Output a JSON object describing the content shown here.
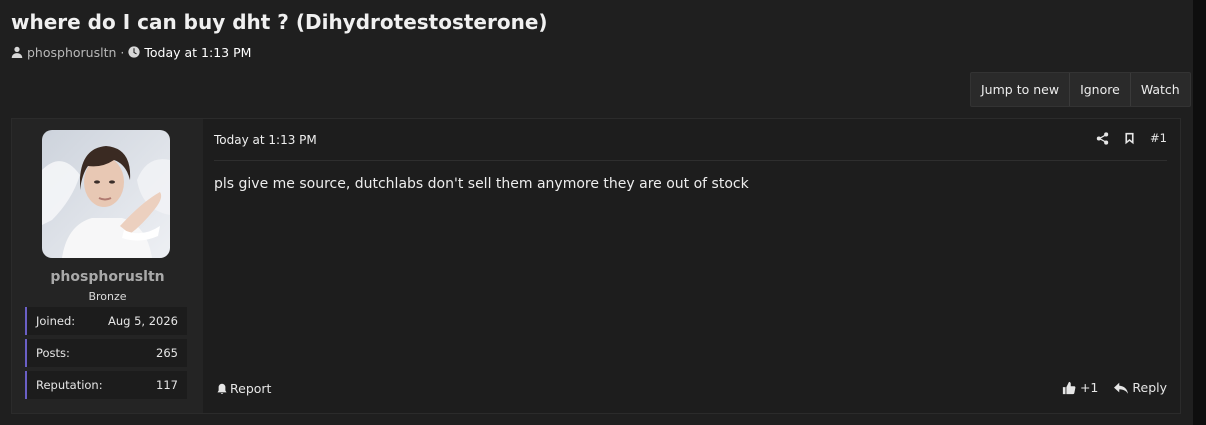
{
  "thread": {
    "title": "where do I can buy dht ? (Dihydrotestosterone)",
    "author": "phosphorusltn",
    "separator": "·",
    "time": "Today at 1:13 PM"
  },
  "actions": {
    "jump_to_new": "Jump to new",
    "ignore": "Ignore",
    "watch": "Watch"
  },
  "post": {
    "username": "phosphorusltn",
    "rank": "Bronze",
    "stats": [
      {
        "label": "Joined:",
        "value": "Aug 5, 2026"
      },
      {
        "label": "Posts:",
        "value": "265"
      },
      {
        "label": "Reputation:",
        "value": "117"
      }
    ],
    "date": "Today at 1:13 PM",
    "number": "#1",
    "body": "pls give me source, dutchlabs don't sell them anymore they are out of stock",
    "report_label": "Report",
    "like_count": "+1",
    "reply_label": "Reply"
  },
  "icons": {
    "user": "user-icon",
    "clock": "clock-icon",
    "share": "share-icon",
    "bookmark": "bookmark-icon",
    "bell": "bell-icon",
    "thumbs_up": "thumbs-up-icon",
    "reply": "reply-icon"
  },
  "colors": {
    "background": "#1f1f1f",
    "user_panel": "#242424",
    "stat_accent": "#6a5fc5"
  }
}
